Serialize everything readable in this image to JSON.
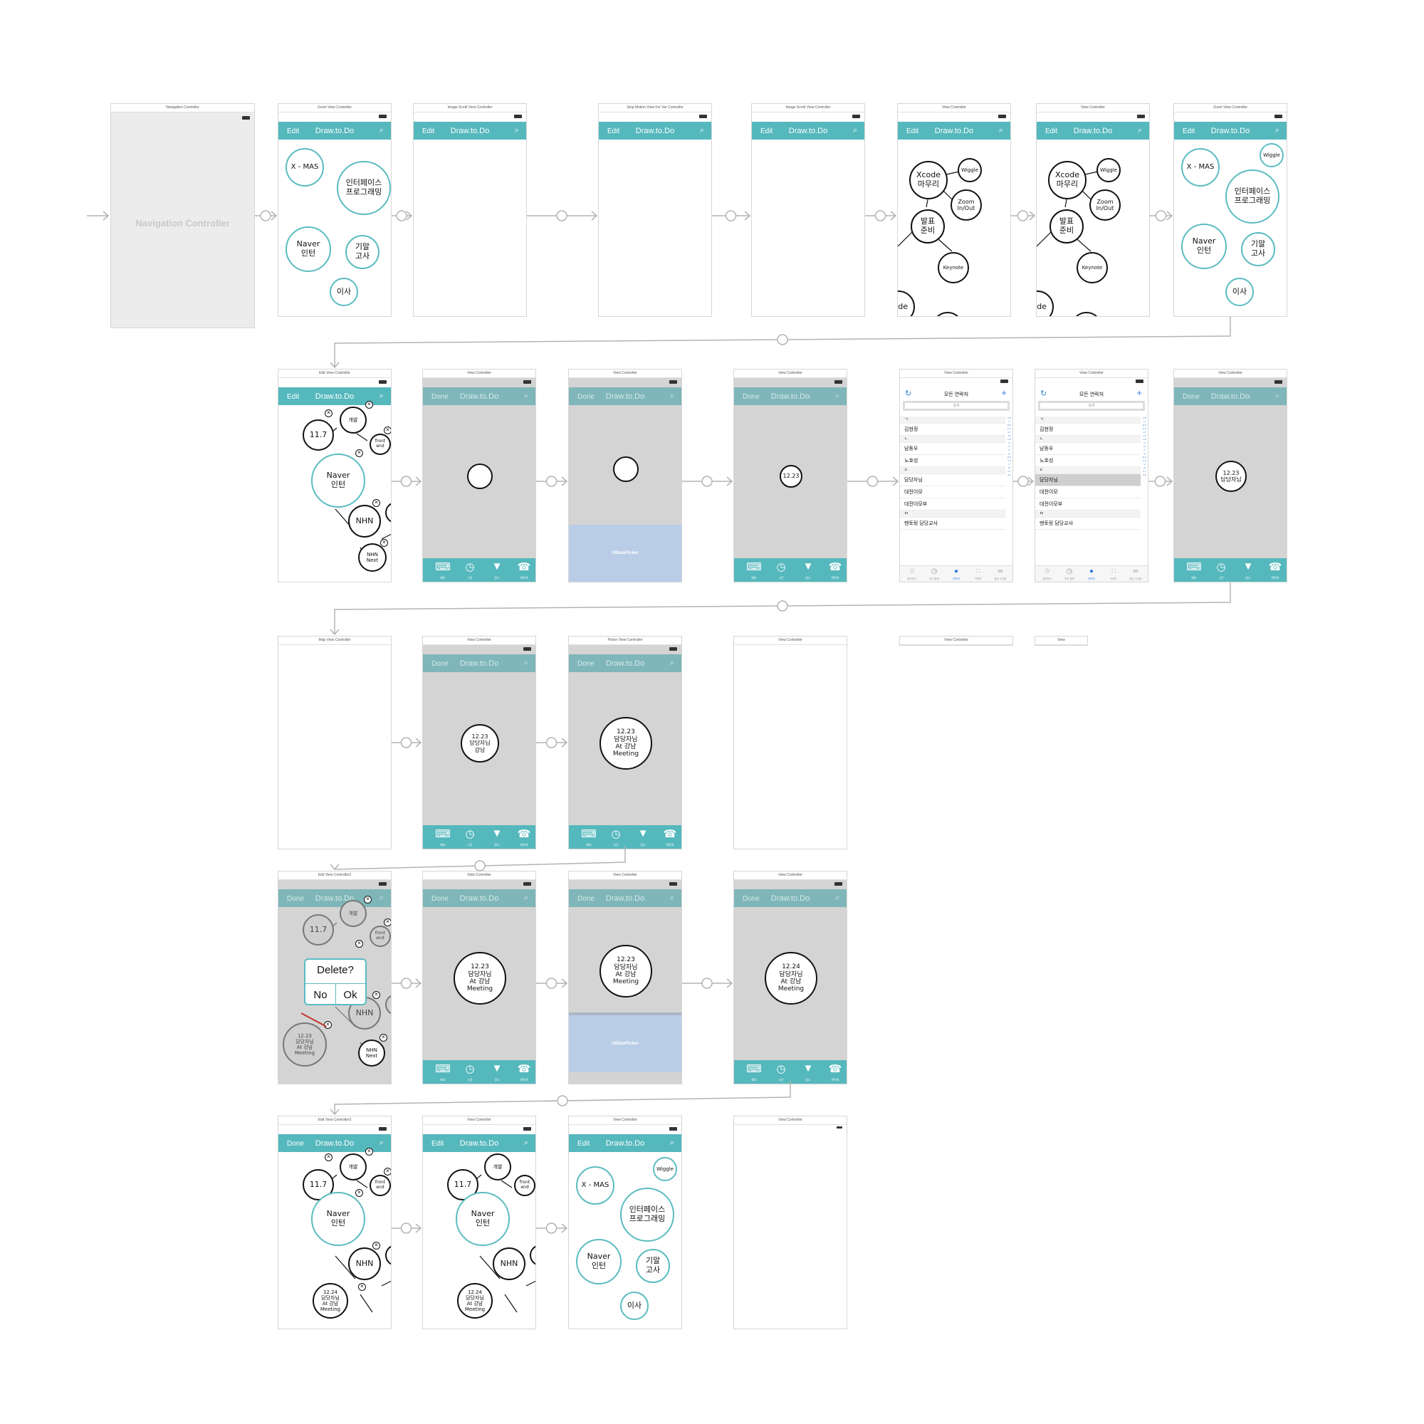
{
  "app": {
    "header_title": "Draw.to.Do",
    "edit_label": "Edit",
    "done_label": "Done",
    "search_icon": "search-icon",
    "datepicker_label": "UIDatePicker",
    "tab_labels": [
      "메모",
      "시간",
      "장소",
      "연락처"
    ],
    "tab_icons": [
      "keyboard-icon",
      "clock-icon",
      "pin-icon",
      "phone-icon"
    ]
  },
  "scenes": {
    "nav": {
      "title": "Navigation Controller",
      "label": "Navigation Controller"
    },
    "zoom1": {
      "title": "Zoom View Controller"
    },
    "imgscroll1": {
      "title": "Image Scroll View Controller"
    },
    "stopmotion": {
      "title": "Stop Motion View For Var Controller"
    },
    "imgscroll2": {
      "title": "Image Scroll View Controller"
    },
    "view1": {
      "title": "View Controller"
    },
    "view2": {
      "title": "View Controller"
    },
    "zoom2": {
      "title": "Zoom View Controller"
    },
    "edit1": {
      "title": "Edit View Controller"
    },
    "r2v1": {
      "title": "View Controller"
    },
    "r2v2": {
      "title": "View Controller"
    },
    "r2v3": {
      "title": "View Controller"
    },
    "contacts1": {
      "title": "View Controller"
    },
    "contacts2": {
      "title": "View Controller"
    },
    "r2v6": {
      "title": "View Controller"
    },
    "map": {
      "title": "Map View Controller"
    },
    "r3v1": {
      "title": "View Controller"
    },
    "picker": {
      "title": "Picker View Controller"
    },
    "r3v3": {
      "title": "View Controller"
    },
    "r3v4": {
      "title": "View Controller"
    },
    "r3v5": {
      "title": "View"
    },
    "edit2": {
      "title": "Edit View Controller2"
    },
    "r4v1": {
      "title": "View Controller"
    },
    "r4v2": {
      "title": "View Controller"
    },
    "r4v3": {
      "title": "View Controller"
    },
    "edit3": {
      "title": "Edit View Controller3"
    },
    "r5v1": {
      "title": "View Controller"
    },
    "r5v2": {
      "title": "View Controller"
    },
    "r5v3": {
      "title": "View Controller"
    }
  },
  "bubbles": {
    "xmas": "X - MAS",
    "interface": "인터페이스\n프로그래밍",
    "naver": "Naver\n인턴",
    "exam": "기말\n고사",
    "move": "이사",
    "wiggle": "Wiggle",
    "xcode": "Xcode\n마무리",
    "zoom": "Zoom\nIn/Out",
    "present": "발표\n준비",
    "keynote": "Keynote",
    "ode": "ode",
    "d117": "11.7",
    "dev": "개발",
    "frontend": "front\nend",
    "nhn": "NHN",
    "nhnnext": "NHN\nNext",
    "d1223": "12.23",
    "d1223_mgr": "12.23\n담당자님",
    "d1223_mgr_gn": "12.23\n담당자님\n강남",
    "d1223_full": "12.23\n담당자님\nAt 강남\nMeeting",
    "d1224_full": "12.24\n담당자님\nAt 강남\nMeeting"
  },
  "dialog": {
    "question": "Delete?",
    "no": "No",
    "ok": "Ok"
  },
  "contacts": {
    "title": "모든 연락처",
    "search_placeholder": "검색",
    "rows": [
      {
        "text": "ㄱ",
        "header": true
      },
      {
        "text": "김현정",
        "header": false
      },
      {
        "text": "ㄴ",
        "header": true
      },
      {
        "text": "남동우",
        "header": false
      },
      {
        "text": "노호성",
        "header": false
      },
      {
        "text": "ㄷ",
        "header": true
      },
      {
        "text": "담당자님",
        "header": false
      },
      {
        "text": "대전이모",
        "header": false
      },
      {
        "text": "대전이모부",
        "header": false
      },
      {
        "text": "ㅁ",
        "header": true
      },
      {
        "text": "멘토링 담당교사",
        "header": false
      }
    ],
    "index": "A B C D E F G H I J K L M N O P Q R S T U V W X Y Z #",
    "tab_labels": [
      "즐겨찾기",
      "최근 통화",
      "연락처",
      "키패드",
      "음성 사서함"
    ],
    "tab_icons": [
      "star-icon",
      "recent-icon",
      "person-icon",
      "keypad-icon",
      "voicemail-icon"
    ]
  },
  "colors": {
    "teal": "#55b8bd",
    "teal_border": "#5bbcc1",
    "picker": "#b9cde6",
    "gray_bg": "#d4d4d4",
    "ios_blue": "#2f7fdb"
  }
}
